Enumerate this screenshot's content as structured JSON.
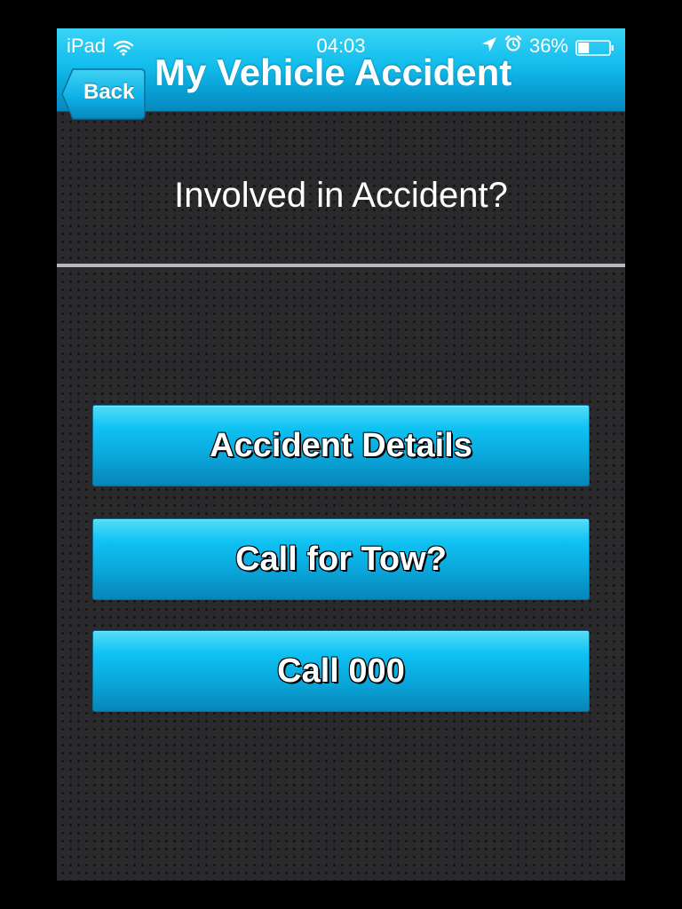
{
  "status_bar": {
    "device": "iPad",
    "time": "04:03",
    "battery": "36%",
    "battery_level": 0.36,
    "icons": [
      "wifi-icon",
      "location-arrow-icon",
      "alarm-icon",
      "battery-icon"
    ]
  },
  "nav": {
    "back_label": "Back",
    "title": "My Vehicle Accident"
  },
  "main": {
    "question": "Involved in Accident?",
    "buttons": [
      {
        "label": "Accident Details"
      },
      {
        "label": "Call for Tow?"
      },
      {
        "label": "Call 000"
      }
    ]
  },
  "colors": {
    "accent": "#0fbdf0",
    "background": "#2a2a2c",
    "divider": "#b9b9bb"
  }
}
